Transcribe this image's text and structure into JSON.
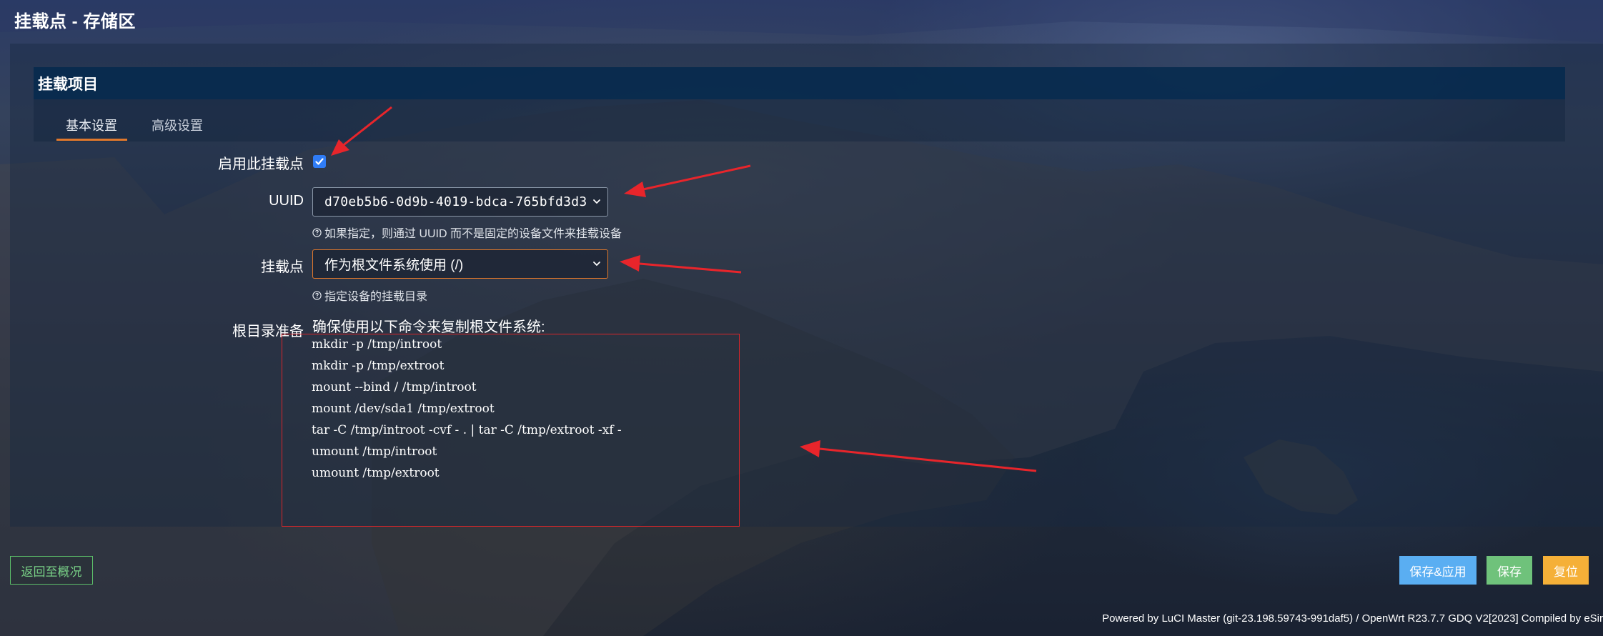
{
  "page": {
    "title": "挂载点 - 存储区"
  },
  "section": {
    "title": "挂载项目",
    "tabs": [
      {
        "label": "基本设置",
        "active": true
      },
      {
        "label": "高级设置",
        "active": false
      }
    ]
  },
  "form": {
    "enable": {
      "label": "启用此挂载点",
      "checked": true
    },
    "uuid": {
      "label": "UUID",
      "value": "d70eb5b6-0d9b-4019-bdca-765bfd3d3",
      "hint": "如果指定，则通过 UUID 而不是固定的设备文件来挂载设备"
    },
    "mountpoint": {
      "label": "挂载点",
      "value": "作为根文件系统使用 (/)",
      "hint": "指定设备的挂载目录"
    },
    "rootprep": {
      "label": "根目录准备",
      "intro": "确保使用以下命令来复制根文件系统:",
      "commands": [
        "mkdir -p /tmp/introot",
        "mkdir -p /tmp/extroot",
        "mount --bind / /tmp/introot",
        "mount /dev/sda1 /tmp/extroot",
        "tar -C /tmp/introot -cvf - . | tar -C /tmp/extroot -xf -",
        "umount /tmp/introot",
        "umount /tmp/extroot"
      ]
    }
  },
  "buttons": {
    "back": "返回至概况",
    "save_apply": "保存&应用",
    "save": "保存",
    "reset": "复位"
  },
  "footer": {
    "text": "Powered by LuCI Master (git-23.198.59743-991daf5) / OpenWrt R23.7.7 GDQ V2[2023] Compiled by eSir"
  },
  "colors": {
    "accent": "#e0782c",
    "annotation_red": "#e8252b",
    "checkbox_blue": "#2f7cf6",
    "btn_save_apply": "#5aaef2",
    "btn_save": "#6fc27b",
    "btn_reset": "#f5b038",
    "btn_back_border": "#5cc06a"
  },
  "icons": {
    "help": "help-circle-icon",
    "dropdown": "chevron-down-icon",
    "check": "checkmark-icon"
  }
}
